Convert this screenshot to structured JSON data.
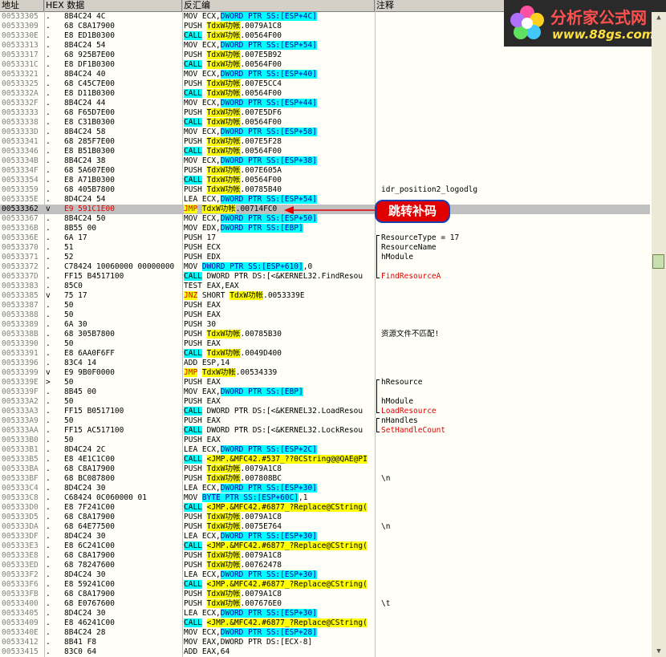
{
  "columns": {
    "addr": "地址",
    "hex": "HEX 数据",
    "asm": "反汇编",
    "cmt": "注释"
  },
  "logo": {
    "title": "分析家公式网",
    "url": "www.88gs.com"
  },
  "callout": {
    "label": "跳转补码",
    "color": "#e00000"
  },
  "colors": {
    "call_highlight": "#00ffff",
    "jmp_highlight": "#ffff00",
    "selected_row": "#c0c0c0"
  },
  "rows": [
    {
      "addr": "00533305",
      "mark": ".",
      "hex": "8B4C24 4C",
      "asm": "MOV ECX,DWORD PTR SS:[ESP+4C]",
      "cmt": ""
    },
    {
      "addr": "00533309",
      "mark": ".",
      "hex": "68 C8A17900",
      "asm": "PUSH TdxW功帐.0079A1C8",
      "cmt": ""
    },
    {
      "addr": "0053330E",
      "mark": ".",
      "hex": "E8 ED1B0300",
      "asm": "CALL TdxW功帐.00564F00",
      "cmt": ""
    },
    {
      "addr": "00533313",
      "mark": ".",
      "hex": "8B4C24 54",
      "asm": "MOV ECX,DWORD PTR SS:[ESP+54]",
      "cmt": ""
    },
    {
      "addr": "00533317",
      "mark": ".",
      "hex": "68 925B7E00",
      "asm": "PUSH TdxW功帐.007E5B92",
      "cmt": ""
    },
    {
      "addr": "0053331C",
      "mark": ".",
      "hex": "E8 DF1B0300",
      "asm": "CALL TdxW功帐.00564F00",
      "cmt": ""
    },
    {
      "addr": "00533321",
      "mark": ".",
      "hex": "8B4C24 40",
      "asm": "MOV ECX,DWORD PTR SS:[ESP+40]",
      "cmt": ""
    },
    {
      "addr": "00533325",
      "mark": ".",
      "hex": "68 C45C7E00",
      "asm": "PUSH TdxW功帐.007E5CC4",
      "cmt": ""
    },
    {
      "addr": "0053332A",
      "mark": ".",
      "hex": "E8 D11B0300",
      "asm": "CALL TdxW功帐.00564F00",
      "cmt": ""
    },
    {
      "addr": "0053332F",
      "mark": ".",
      "hex": "8B4C24 44",
      "asm": "MOV ECX,DWORD PTR SS:[ESP+44]",
      "cmt": ""
    },
    {
      "addr": "00533333",
      "mark": ".",
      "hex": "68 F65D7E00",
      "asm": "PUSH TdxW功帐.007E5DF6",
      "cmt": ""
    },
    {
      "addr": "00533338",
      "mark": ".",
      "hex": "E8 C31B0300",
      "asm": "CALL TdxW功帐.00564F00",
      "cmt": ""
    },
    {
      "addr": "0053333D",
      "mark": ".",
      "hex": "8B4C24 58",
      "asm": "MOV ECX,DWORD PTR SS:[ESP+58]",
      "cmt": ""
    },
    {
      "addr": "00533341",
      "mark": ".",
      "hex": "68 285F7E00",
      "asm": "PUSH TdxW功帐.007E5F28",
      "cmt": ""
    },
    {
      "addr": "00533346",
      "mark": ".",
      "hex": "E8 B51B0300",
      "asm": "CALL TdxW功帐.00564F00",
      "cmt": ""
    },
    {
      "addr": "0053334B",
      "mark": ".",
      "hex": "8B4C24 38",
      "asm": "MOV ECX,DWORD PTR SS:[ESP+38]",
      "cmt": ""
    },
    {
      "addr": "0053334F",
      "mark": ".",
      "hex": "68 5A607E00",
      "asm": "PUSH TdxW功帐.007E605A",
      "cmt": ""
    },
    {
      "addr": "00533354",
      "mark": ".",
      "hex": "E8 A71B0300",
      "asm": "CALL TdxW功帐.00564F00",
      "cmt": ""
    },
    {
      "addr": "00533359",
      "mark": ".",
      "hex": "68 405B7800",
      "asm": "PUSH TdxW功帐.00785B40",
      "cmt": "idr_position2_logodlg"
    },
    {
      "addr": "0053335E",
      "mark": ".",
      "hex": "8D4C24 54",
      "asm": "LEA ECX,DWORD PTR SS:[ESP+54]",
      "cmt": ""
    },
    {
      "addr": "00533362",
      "mark": "v",
      "hex": "E9 591C1E00",
      "asm": "JMP TdxW功帐.00714FC0",
      "cmt": "",
      "sel": true
    },
    {
      "addr": "00533367",
      "mark": ".",
      "hex": "8B4C24 50",
      "asm": "MOV ECX,DWORD PTR SS:[ESP+50]",
      "cmt": ""
    },
    {
      "addr": "0053336B",
      "mark": ".",
      "hex": "8B55 00",
      "asm": "MOV EDX,DWORD PTR SS:[EBP]",
      "cmt": ""
    },
    {
      "addr": "0053336E",
      "mark": ".",
      "hex": "6A 17",
      "asm": "PUSH 17",
      "cmt": "ResourceType = 17"
    },
    {
      "addr": "00533370",
      "mark": ".",
      "hex": "51",
      "asm": "PUSH ECX",
      "cmt": "ResourceName"
    },
    {
      "addr": "00533371",
      "mark": ".",
      "hex": "52",
      "asm": "PUSH EDX",
      "cmt": "hModule"
    },
    {
      "addr": "00533372",
      "mark": ".",
      "hex": "C78424 10060000 00000000",
      "asm": "MOV DWORD PTR SS:[ESP+610],0",
      "cmt": ""
    },
    {
      "addr": "0053337D",
      "mark": ".",
      "hex": "FF15 B4517100",
      "asm": "CALL DWORD PTR DS:[<&KERNEL32.FindResou",
      "cmt": "FindResourceA"
    },
    {
      "addr": "00533383",
      "mark": ".",
      "hex": "85C0",
      "asm": "TEST EAX,EAX",
      "cmt": ""
    },
    {
      "addr": "00533385",
      "mark": "v",
      "hex": "75 17",
      "asm": "JNZ SHORT TdxW功帐.0053339E",
      "cmt": ""
    },
    {
      "addr": "00533387",
      "mark": ".",
      "hex": "50",
      "asm": "PUSH EAX",
      "cmt": ""
    },
    {
      "addr": "00533388",
      "mark": ".",
      "hex": "50",
      "asm": "PUSH EAX",
      "cmt": ""
    },
    {
      "addr": "00533389",
      "mark": ".",
      "hex": "6A 30",
      "asm": "PUSH 30",
      "cmt": ""
    },
    {
      "addr": "0053338B",
      "mark": ".",
      "hex": "68 305B7800",
      "asm": "PUSH TdxW功帐.00785B30",
      "cmt": "资源文件不匹配!"
    },
    {
      "addr": "00533390",
      "mark": ".",
      "hex": "50",
      "asm": "PUSH EAX",
      "cmt": ""
    },
    {
      "addr": "00533391",
      "mark": ".",
      "hex": "E8 6AA0F6FF",
      "asm": "CALL TdxW功帐.0049D400",
      "cmt": ""
    },
    {
      "addr": "00533396",
      "mark": ".",
      "hex": "83C4 14",
      "asm": "ADD ESP,14",
      "cmt": ""
    },
    {
      "addr": "00533399",
      "mark": "v",
      "hex": "E9 9B0F0000",
      "asm": "JMP TdxW功帐.00534339",
      "cmt": ""
    },
    {
      "addr": "0053339E",
      "mark": ">",
      "hex": "50",
      "asm": "PUSH EAX",
      "cmt": "hResource"
    },
    {
      "addr": "0053339F",
      "mark": ".",
      "hex": "8B45 00",
      "asm": "MOV EAX,DWORD PTR SS:[EBP]",
      "cmt": ""
    },
    {
      "addr": "005333A2",
      "mark": ".",
      "hex": "50",
      "asm": "PUSH EAX",
      "cmt": "hModule"
    },
    {
      "addr": "005333A3",
      "mark": ".",
      "hex": "FF15 B0517100",
      "asm": "CALL DWORD PTR DS:[<&KERNEL32.LoadResou",
      "cmt": "LoadResource"
    },
    {
      "addr": "005333A9",
      "mark": ".",
      "hex": "50",
      "asm": "PUSH EAX",
      "cmt": "nHandles"
    },
    {
      "addr": "005333AA",
      "mark": ".",
      "hex": "FF15 AC517100",
      "asm": "CALL DWORD PTR DS:[<&KERNEL32.LockResou",
      "cmt": "SetHandleCount"
    },
    {
      "addr": "005333B0",
      "mark": ".",
      "hex": "50",
      "asm": "PUSH EAX",
      "cmt": ""
    },
    {
      "addr": "005333B1",
      "mark": ".",
      "hex": "8D4C24 2C",
      "asm": "LEA ECX,DWORD PTR SS:[ESP+2C]",
      "cmt": ""
    },
    {
      "addr": "005333B5",
      "mark": ".",
      "hex": "E8 4E1C1C00",
      "asm": "CALL <JMP.&MFC42.#537_??0CString@@QAE@PI",
      "cmt": ""
    },
    {
      "addr": "005333BA",
      "mark": ".",
      "hex": "68 C8A17900",
      "asm": "PUSH TdxW功帐.0079A1C8",
      "cmt": ""
    },
    {
      "addr": "005333BF",
      "mark": ".",
      "hex": "68 BC087800",
      "asm": "PUSH TdxW功帐.007808BC",
      "cmt": "\\n"
    },
    {
      "addr": "005333C4",
      "mark": ".",
      "hex": "8D4C24 30",
      "asm": "LEA ECX,DWORD PTR SS:[ESP+30]",
      "cmt": ""
    },
    {
      "addr": "005333C8",
      "mark": ".",
      "hex": "C68424 0C060000 01",
      "asm": "MOV BYTE PTR SS:[ESP+60C],1",
      "cmt": ""
    },
    {
      "addr": "005333D0",
      "mark": ".",
      "hex": "E8 7F241C00",
      "asm": "CALL <JMP.&MFC42.#6877_?Replace@CString(",
      "cmt": ""
    },
    {
      "addr": "005333D5",
      "mark": ".",
      "hex": "68 C8A17900",
      "asm": "PUSH TdxW功帐.0079A1C8",
      "cmt": ""
    },
    {
      "addr": "005333DA",
      "mark": ".",
      "hex": "68 64E77500",
      "asm": "PUSH TdxW功帐.0075E764",
      "cmt": "\\n"
    },
    {
      "addr": "005333DF",
      "mark": ".",
      "hex": "8D4C24 30",
      "asm": "LEA ECX,DWORD PTR SS:[ESP+30]",
      "cmt": ""
    },
    {
      "addr": "005333E3",
      "mark": ".",
      "hex": "E8 6C241C00",
      "asm": "CALL <JMP.&MFC42.#6877_?Replace@CString(",
      "cmt": ""
    },
    {
      "addr": "005333E8",
      "mark": ".",
      "hex": "68 C8A17900",
      "asm": "PUSH TdxW功帐.0079A1C8",
      "cmt": ""
    },
    {
      "addr": "005333ED",
      "mark": ".",
      "hex": "68 78247600",
      "asm": "PUSH TdxW功帐.00762478",
      "cmt": ""
    },
    {
      "addr": "005333F2",
      "mark": ".",
      "hex": "8D4C24 30",
      "asm": "LEA ECX,DWORD PTR SS:[ESP+30]",
      "cmt": ""
    },
    {
      "addr": "005333F6",
      "mark": ".",
      "hex": "E8 59241C00",
      "asm": "CALL <JMP.&MFC42.#6877_?Replace@CString(",
      "cmt": ""
    },
    {
      "addr": "005333FB",
      "mark": ".",
      "hex": "68 C8A17900",
      "asm": "PUSH TdxW功帐.0079A1C8",
      "cmt": ""
    },
    {
      "addr": "00533400",
      "mark": ".",
      "hex": "68 E0767600",
      "asm": "PUSH TdxW功帐.007676E0",
      "cmt": "\\t"
    },
    {
      "addr": "00533405",
      "mark": ".",
      "hex": "8D4C24 30",
      "asm": "LEA ECX,DWORD PTR SS:[ESP+30]",
      "cmt": ""
    },
    {
      "addr": "00533409",
      "mark": ".",
      "hex": "E8 46241C00",
      "asm": "CALL <JMP.&MFC42.#6877_?Replace@CString(",
      "cmt": ""
    },
    {
      "addr": "0053340E",
      "mark": ".",
      "hex": "8B4C24 28",
      "asm": "MOV ECX,DWORD PTR SS:[ESP+28]",
      "cmt": ""
    },
    {
      "addr": "00533412",
      "mark": ".",
      "hex": "8B41 F8",
      "asm": "MOV EAX,DWORD PTR DS:[ECX-8]",
      "cmt": ""
    },
    {
      "addr": "00533415",
      "mark": ".",
      "hex": "83C0 64",
      "asm": "ADD EAX,64",
      "cmt": ""
    }
  ]
}
